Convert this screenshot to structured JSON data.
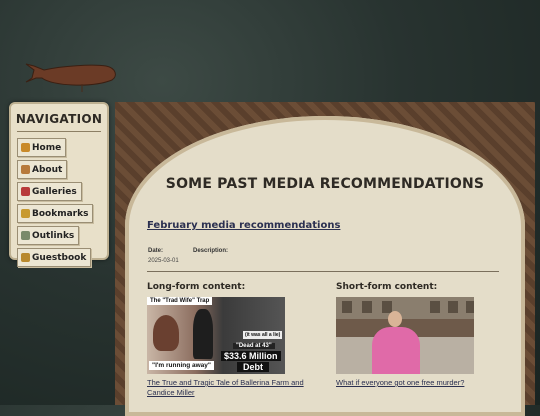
{
  "nav": {
    "title": "NAVIGATION",
    "items": [
      {
        "label": "Home",
        "icon": "home-icon",
        "color": "#c98a2a"
      },
      {
        "label": "About",
        "icon": "about-icon",
        "color": "#b77a3c"
      },
      {
        "label": "Galleries",
        "icon": "galleries-icon",
        "color": "#b83a3a"
      },
      {
        "label": "Bookmarks",
        "icon": "bookmarks-icon",
        "color": "#c89a30"
      },
      {
        "label": "Outlinks",
        "icon": "outlinks-icon",
        "color": "#7a8a6a"
      },
      {
        "label": "Guestbook",
        "icon": "guestbook-icon",
        "color": "#b8892e"
      }
    ]
  },
  "main": {
    "title": "SOME PAST MEDIA RECOMMENDATIONS",
    "post": {
      "title": "February media recommendations",
      "date_label": "Date:",
      "date_value": "2025-03-01",
      "description_label": "Description:"
    },
    "long_form": {
      "heading": "Long-form content:",
      "thumb_top": "The \"Trad Wife\" Trap",
      "thumb_quote1": "\"I'm running away\"",
      "thumb_quote2": "(it was all a lie)",
      "thumb_quote3": "\"Dead at 43\"",
      "thumb_amount": "$33.6 Million",
      "thumb_debt": "Debt",
      "link": "The True and Tragic Tale of Ballerina Farm and Candice Miller"
    },
    "short_form": {
      "heading": "Short-form content:",
      "link": "What if everyone got one free murder?"
    }
  }
}
